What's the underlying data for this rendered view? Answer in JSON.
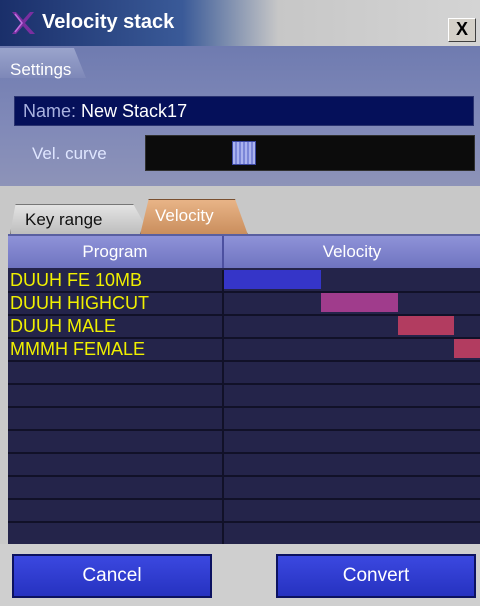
{
  "window": {
    "title": "Velocity stack",
    "close_label": "X"
  },
  "settings": {
    "section_label": "Settings",
    "name_label": "Name:",
    "name_value": "New Stack17",
    "vel_curve_label": "Vel. curve",
    "vel_curve_value": 0.28
  },
  "tabs": [
    {
      "label": "Key range",
      "active": false
    },
    {
      "label": "Velocity",
      "active": true
    }
  ],
  "table": {
    "columns": [
      "Program",
      "Velocity"
    ],
    "rows": [
      {
        "program": "DUUH FE 10MB",
        "vel_start": 0.0,
        "vel_end": 0.38,
        "color": "#3535c8"
      },
      {
        "program": "DUUH HIGHCUT",
        "vel_start": 0.38,
        "vel_end": 0.68,
        "color": "#a03c8c"
      },
      {
        "program": "DUUH MALE",
        "vel_start": 0.68,
        "vel_end": 0.9,
        "color": "#b23c60"
      },
      {
        "program": "MMMH FEMALE",
        "vel_start": 0.9,
        "vel_end": 1.0,
        "color": "#b23c60"
      },
      {
        "program": ""
      },
      {
        "program": ""
      },
      {
        "program": ""
      },
      {
        "program": ""
      },
      {
        "program": ""
      },
      {
        "program": ""
      },
      {
        "program": ""
      },
      {
        "program": ""
      }
    ]
  },
  "buttons": {
    "cancel": "Cancel",
    "convert": "Convert"
  }
}
